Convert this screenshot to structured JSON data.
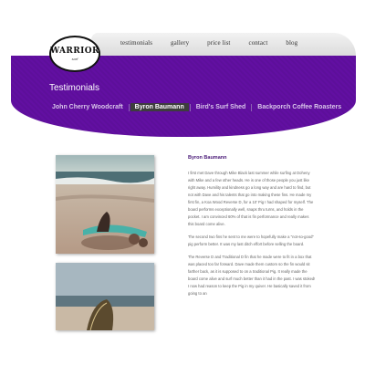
{
  "logo": {
    "title": "WARRIOR",
    "subtitle": "surf"
  },
  "nav": {
    "items": [
      "testimonials",
      "gallery",
      "price list",
      "contact",
      "blog"
    ]
  },
  "header": {
    "title": "Testimonials"
  },
  "subnav": {
    "items": [
      "John Cherry Woodcraft",
      "Byron Baumann",
      "Bird's Surf Shed",
      "Backporch Coffee Roasters"
    ],
    "active_index": 1
  },
  "article": {
    "title": "Byron Baumann",
    "paragraphs": [
      "I first met Dave through Mike Black last summer while surfing at Doheny with Mike and a few other heads. He is one of those people you just like right away. Humility and kindness go a long way and are hard to find, but not with Dave and his talents that go into making these fins. He made my first fin, a Koa Wood Reverse D, for a 10' Pig I had shaped for myself. The board performs exceptionally well, snaps thru turns, and holds in the pocket. I am convinced 60% of that is fin performance and really makes this board come alive.",
      "The second two fins he sent to me were to hopefully make a \"not-so-good\" pig perform better. It was my last ditch effort before selling the board.",
      "The Reverse D and Traditional D fin that he made were to fit in a box that was placed too far forward. Dave made them custom so the fin would sit farther back, as it is supposed to on a traditional Pig. It really made the board come alive and surf much better than it had in the past. I was stoked! I now had reason to keep the Pig in my quiver. He basically saved it from going to an"
    ]
  },
  "colors": {
    "brand_purple": "#5d0f9a",
    "active_tab": "#3d3d3d"
  },
  "photos": [
    "surfboard-on-beach-photo",
    "surfboard-closeup-photo"
  ]
}
